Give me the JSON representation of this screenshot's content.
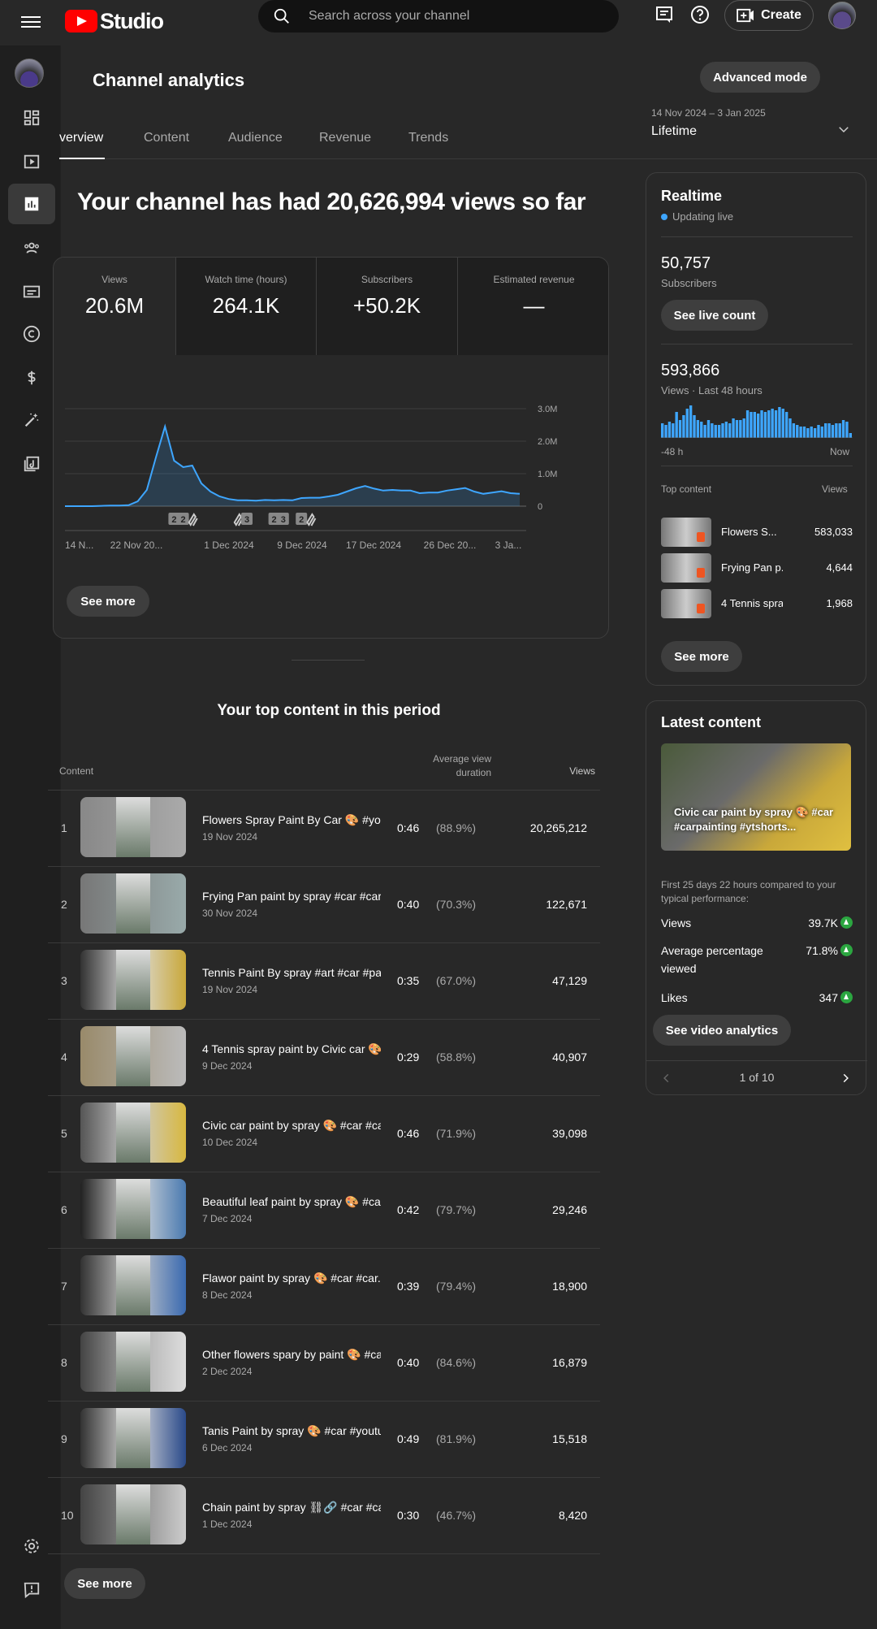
{
  "app": {
    "brand": "Studio"
  },
  "search": {
    "placeholder": "Search across your channel"
  },
  "header": {
    "create_label": "Create"
  },
  "page": {
    "title": "Channel analytics",
    "advanced_mode": "Advanced mode",
    "tabs": [
      "Overview",
      "Content",
      "Audience",
      "Revenue",
      "Trends"
    ],
    "active_tab_visible": "verview",
    "range_dates": "14 Nov 2024 – 3 Jan 2025",
    "range_label": "Lifetime",
    "headline": "Your channel has had 20,626,994 views so far"
  },
  "metrics": [
    {
      "label": "Views",
      "value": "20.6M"
    },
    {
      "label": "Watch time (hours)",
      "value": "264.1K"
    },
    {
      "label": "Subscribers",
      "value": "+50.2K"
    },
    {
      "label": "Estimated revenue",
      "value": "—"
    }
  ],
  "chart_data": {
    "type": "area",
    "x": [
      "14 Nov",
      "15 Nov",
      "16 Nov",
      "17 Nov",
      "18 Nov",
      "19 Nov",
      "20 Nov",
      "21 Nov",
      "22 Nov",
      "23 Nov",
      "24 Nov",
      "25 Nov",
      "26 Nov",
      "27 Nov",
      "28 Nov",
      "29 Nov",
      "30 Nov",
      "1 Dec",
      "2 Dec",
      "3 Dec",
      "4 Dec",
      "5 Dec",
      "6 Dec",
      "7 Dec",
      "8 Dec",
      "9 Dec",
      "10 Dec",
      "11 Dec",
      "12 Dec",
      "13 Dec",
      "14 Dec",
      "15 Dec",
      "16 Dec",
      "17 Dec",
      "18 Dec",
      "19 Dec",
      "20 Dec",
      "21 Dec",
      "22 Dec",
      "23 Dec",
      "24 Dec",
      "25 Dec",
      "26 Dec",
      "27 Dec",
      "28 Dec",
      "29 Dec",
      "30 Dec",
      "31 Dec",
      "1 Jan",
      "2 Jan",
      "3 Jan"
    ],
    "series": [
      {
        "values": [
          0,
          0,
          0,
          0,
          10000,
          20000,
          20000,
          30000,
          150000,
          500000,
          1500000,
          2450000,
          1400000,
          1200000,
          1250000,
          700000,
          450000,
          300000,
          220000,
          180000,
          180000,
          170000,
          190000,
          180000,
          190000,
          180000,
          250000,
          260000,
          260000,
          300000,
          350000,
          450000,
          550000,
          620000,
          540000,
          480000,
          500000,
          480000,
          480000,
          400000,
          420000,
          420000,
          480000,
          520000,
          560000,
          450000,
          380000,
          420000,
          460000,
          400000,
          380000
        ]
      }
    ],
    "x_tick_labels": [
      "14 N...",
      "22 Nov 20...",
      "1 Dec 2024",
      "9 Dec 2024",
      "17 Dec 2024",
      "26 Dec 20...",
      "3 Ja..."
    ],
    "y_tick_labels": [
      "3.0M",
      "2.0M",
      "1.0M",
      "0"
    ],
    "ylim": [
      0,
      3000000
    ],
    "markers": [
      "2",
      "2",
      "shorts",
      "shorts",
      "3",
      "2",
      "3",
      "2",
      "shorts"
    ],
    "grid": true,
    "accent": "#3ea6ff"
  },
  "overview": {
    "see_more": "See more"
  },
  "top_content": {
    "title": "Your top content in this period",
    "headers": {
      "content": "Content",
      "avd": "Average view duration",
      "views": "Views"
    },
    "rows": [
      {
        "rank": "1",
        "title": "Flowers Spray Paint By Car 🎨 #you...",
        "date": "19 Nov 2024",
        "duration": "0:46",
        "pct": "(88.9%)",
        "views": "20,265,212"
      },
      {
        "rank": "2",
        "title": "Frying Pan paint by spray #car #car...",
        "date": "30 Nov 2024",
        "duration": "0:40",
        "pct": "(70.3%)",
        "views": "122,671"
      },
      {
        "rank": "3",
        "title": "Tennis Paint By spray #art #car #pa...",
        "date": "19 Nov 2024",
        "duration": "0:35",
        "pct": "(67.0%)",
        "views": "47,129"
      },
      {
        "rank": "4",
        "title": "4 Tennis spray paint by Civic car 🎨...",
        "date": "9 Dec 2024",
        "duration": "0:29",
        "pct": "(58.8%)",
        "views": "40,907"
      },
      {
        "rank": "5",
        "title": "Civic car paint by spray 🎨 #car #ca...",
        "date": "10 Dec 2024",
        "duration": "0:46",
        "pct": "(71.9%)",
        "views": "39,098"
      },
      {
        "rank": "6",
        "title": "Beautiful leaf paint by spray 🎨 #ca...",
        "date": "7 Dec 2024",
        "duration": "0:42",
        "pct": "(79.7%)",
        "views": "29,246"
      },
      {
        "rank": "7",
        "title": "Flawor paint by spray 🎨 #car #car...",
        "date": "8 Dec 2024",
        "duration": "0:39",
        "pct": "(79.4%)",
        "views": "18,900"
      },
      {
        "rank": "8",
        "title": "Other flowers spary by paint 🎨 #ca...",
        "date": "2 Dec 2024",
        "duration": "0:40",
        "pct": "(84.6%)",
        "views": "16,879"
      },
      {
        "rank": "9",
        "title": "Tanis Paint by spray 🎨 #car #youtu...",
        "date": "6 Dec 2024",
        "duration": "0:49",
        "pct": "(81.9%)",
        "views": "15,518"
      },
      {
        "rank": "10",
        "title": "Chain paint by spray ⛓🔗 #car #car...",
        "date": "1 Dec 2024",
        "duration": "0:30",
        "pct": "(46.7%)",
        "views": "8,420"
      }
    ],
    "see_more": "See more"
  },
  "realtime": {
    "title": "Realtime",
    "live": "Updating live",
    "subs_value": "50,757",
    "subs_label": "Subscribers",
    "live_count_btn": "See live count",
    "views_value": "593,866",
    "views_label": "Views · Last 48 hours",
    "bars": [
      0.45,
      0.4,
      0.5,
      0.45,
      0.8,
      0.55,
      0.7,
      0.9,
      1.0,
      0.7,
      0.55,
      0.5,
      0.4,
      0.55,
      0.45,
      0.4,
      0.4,
      0.45,
      0.5,
      0.45,
      0.6,
      0.55,
      0.55,
      0.6,
      0.85,
      0.8,
      0.8,
      0.75,
      0.85,
      0.8,
      0.85,
      0.9,
      0.85,
      0.95,
      0.9,
      0.8,
      0.6,
      0.45,
      0.4,
      0.35,
      0.35,
      0.3,
      0.35,
      0.3,
      0.4,
      0.35,
      0.45,
      0.45,
      0.4,
      0.45,
      0.45,
      0.55,
      0.5,
      0.15
    ],
    "x_start": "-48 h",
    "x_end": "Now",
    "top_label": "Top content",
    "views_col": "Views",
    "items": [
      {
        "name": "Flowers S...",
        "views": "583,033"
      },
      {
        "name": "Frying Pan p...",
        "views": "4,644"
      },
      {
        "name": "4 Tennis spra...",
        "views": "1,968"
      }
    ],
    "see_more": "See more"
  },
  "latest": {
    "title": "Latest content",
    "thumb_caption": "Civic car paint by spray 🎨 #car #carpainting #ytshorts...",
    "note": "First 25 days 22 hours compared to your typical performance:",
    "stats": [
      {
        "label": "Views",
        "value": "39.7K"
      },
      {
        "label": "Average percentage viewed",
        "value": "71.8%"
      },
      {
        "label": "Likes",
        "value": "347"
      }
    ],
    "analytics_btn": "See video analytics",
    "pager": "1 of 10"
  }
}
